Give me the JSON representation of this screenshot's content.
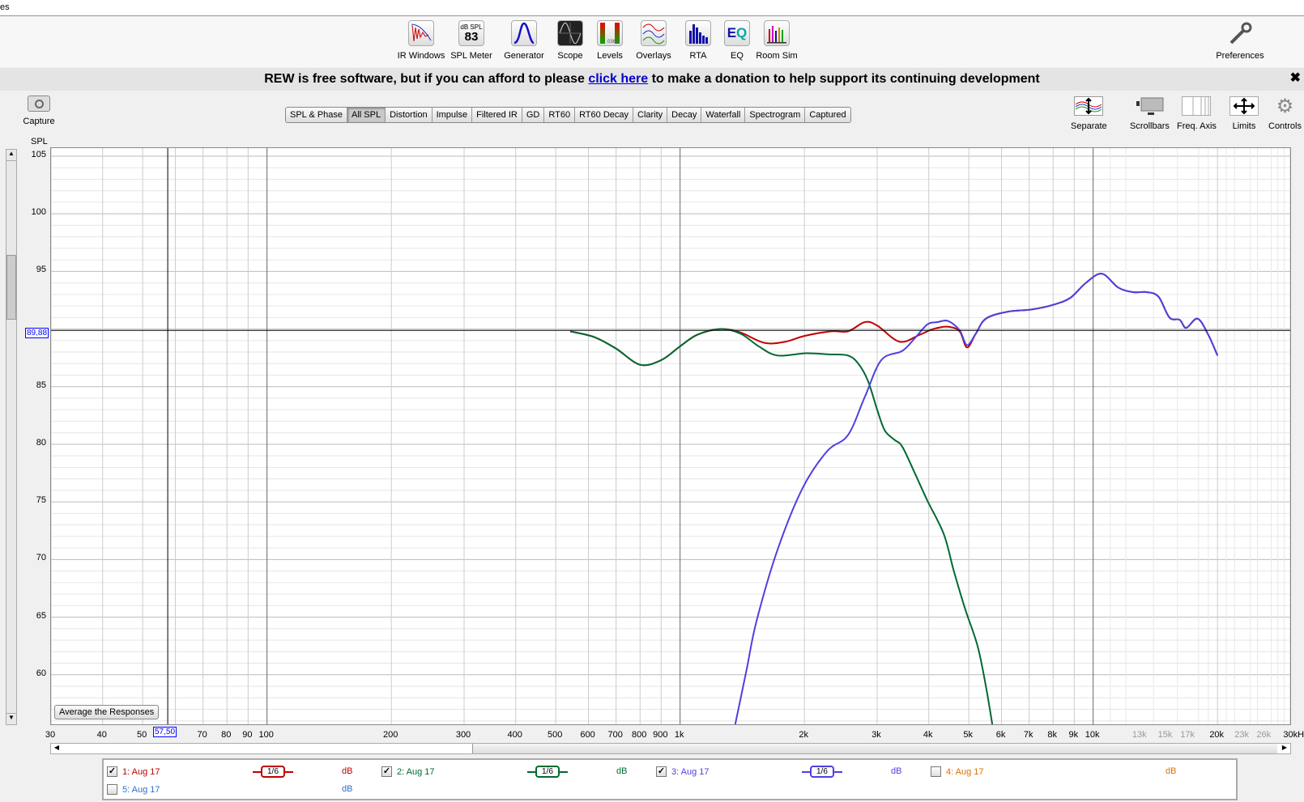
{
  "window": {
    "title_fragment": "es"
  },
  "toolbar": {
    "items": [
      {
        "label": "IR Windows",
        "icon": "ir-windows-icon"
      },
      {
        "label": "SPL Meter",
        "icon": "spl-meter-icon",
        "meter_unit": "dB SPL",
        "meter_value": "83"
      },
      {
        "label": "Generator",
        "icon": "generator-icon"
      },
      {
        "label": "Scope",
        "icon": "scope-icon"
      },
      {
        "label": "Levels",
        "icon": "levels-icon"
      },
      {
        "label": "Overlays",
        "icon": "overlays-icon"
      },
      {
        "label": "RTA",
        "icon": "rta-icon"
      },
      {
        "label": "EQ",
        "icon": "eq-icon"
      },
      {
        "label": "Room Sim",
        "icon": "room-sim-icon"
      }
    ],
    "preferences": "Preferences"
  },
  "banner": {
    "before": "REW is free software, but if you can afford to please ",
    "link": "click here",
    "after": " to make a donation to help support its continuing development",
    "close": "✖"
  },
  "capture": {
    "label": "Capture"
  },
  "tabs": [
    {
      "label": "SPL & Phase"
    },
    {
      "label": "All SPL",
      "active": true
    },
    {
      "label": "Distortion"
    },
    {
      "label": "Impulse"
    },
    {
      "label": "Filtered IR"
    },
    {
      "label": "GD"
    },
    {
      "label": "RT60"
    },
    {
      "label": "RT60 Decay"
    },
    {
      "label": "Clarity"
    },
    {
      "label": "Decay"
    },
    {
      "label": "Waterfall"
    },
    {
      "label": "Spectrogram"
    },
    {
      "label": "Captured"
    }
  ],
  "right_tools": [
    {
      "label": "Separate",
      "icon": "separate-icon"
    },
    {
      "label": "Scrollbars",
      "icon": "scrollbars-icon"
    },
    {
      "label": "Freq. Axis",
      "icon": "freq-axis-icon"
    },
    {
      "label": "Limits",
      "icon": "limits-icon"
    },
    {
      "label": "Controls",
      "icon": "gear-icon"
    }
  ],
  "average_button": "Average the Responses",
  "cursor": {
    "freq_label": "57,50",
    "spl_label": "89,88"
  },
  "legend": [
    {
      "label": "1: Aug 17",
      "checked": true,
      "smoothing": "1/6",
      "unit": "dB",
      "color": "#c00000"
    },
    {
      "label": "2: Aug 17",
      "checked": true,
      "smoothing": "1/6",
      "unit": "dB",
      "color": "#006a30"
    },
    {
      "label": "3: Aug 17",
      "checked": true,
      "smoothing": "1/6",
      "unit": "dB",
      "color": "#5040e0"
    },
    {
      "label": "4: Aug 17",
      "checked": false,
      "unit": "dB",
      "color": "#e07000"
    },
    {
      "label": "5: Aug 17",
      "checked": false,
      "unit": "dB",
      "color": "#2f6fd0"
    }
  ],
  "chart_data": {
    "type": "line",
    "ylabel": "SPL",
    "xscale": "log",
    "xlim": [
      30,
      30000
    ],
    "ylim": [
      55.7,
      105.7
    ],
    "yticks": [
      105,
      100,
      95,
      90,
      85,
      80,
      75,
      70,
      65,
      60
    ],
    "ytick_labels": [
      "105",
      "100",
      "95",
      "",
      "85",
      "80",
      "75",
      "70",
      "65",
      "60"
    ],
    "xticks": [
      {
        "f": 30,
        "label": "30"
      },
      {
        "f": 40,
        "label": "40"
      },
      {
        "f": 50,
        "label": "50"
      },
      {
        "f": 70,
        "label": "70"
      },
      {
        "f": 80,
        "label": "80"
      },
      {
        "f": 90,
        "label": "90"
      },
      {
        "f": 100,
        "label": "100"
      },
      {
        "f": 200,
        "label": "200"
      },
      {
        "f": 300,
        "label": "300"
      },
      {
        "f": 400,
        "label": "400"
      },
      {
        "f": 500,
        "label": "500"
      },
      {
        "f": 600,
        "label": "600"
      },
      {
        "f": 700,
        "label": "700"
      },
      {
        "f": 800,
        "label": "800"
      },
      {
        "f": 900,
        "label": "900"
      },
      {
        "f": 1000,
        "label": "1k"
      },
      {
        "f": 2000,
        "label": "2k"
      },
      {
        "f": 3000,
        "label": "3k"
      },
      {
        "f": 4000,
        "label": "4k"
      },
      {
        "f": 5000,
        "label": "5k"
      },
      {
        "f": 6000,
        "label": "6k"
      },
      {
        "f": 7000,
        "label": "7k"
      },
      {
        "f": 8000,
        "label": "8k"
      },
      {
        "f": 9000,
        "label": "9k"
      },
      {
        "f": 10000,
        "label": "10k"
      },
      {
        "f": 13000,
        "label": "13k",
        "dim": true
      },
      {
        "f": 15000,
        "label": "15k",
        "dim": true
      },
      {
        "f": 17000,
        "label": "17k",
        "dim": true
      },
      {
        "f": 20000,
        "label": "20k"
      },
      {
        "f": 23000,
        "label": "23k",
        "dim": true
      },
      {
        "f": 26000,
        "label": "26k",
        "dim": true
      },
      {
        "f": 30000,
        "label": "30kHz"
      }
    ],
    "cursor": {
      "x": 57.5,
      "y": 89.88
    },
    "grid": true,
    "series": [
      {
        "name": "1: Aug 17",
        "color": "#c00000",
        "x": [
          542,
          620,
          700,
          800,
          900,
          1000,
          1100,
          1250,
          1400,
          1600,
          1800,
          2000,
          2320,
          2550,
          2800,
          3000,
          3400,
          3800,
          4100,
          4450,
          4750,
          4950,
          5200,
          5500,
          6200,
          7100,
          8000,
          8800,
          9600,
          10500,
          11500,
          12500,
          13500,
          14400,
          15300,
          16200,
          16800,
          17900,
          19000,
          20000
        ],
        "y": [
          89.8,
          89.3,
          88.3,
          86.9,
          87.3,
          88.5,
          89.5,
          90.0,
          89.7,
          88.8,
          88.9,
          89.4,
          89.8,
          89.8,
          90.6,
          90.3,
          88.9,
          89.5,
          90.0,
          90.2,
          89.8,
          88.4,
          89.6,
          90.9,
          91.5,
          91.7,
          92.1,
          92.7,
          94.0,
          94.8,
          93.6,
          93.2,
          93.2,
          92.8,
          91.0,
          90.8,
          90.1,
          90.9,
          89.5,
          87.7
        ]
      },
      {
        "name": "2: Aug 17",
        "color": "#006a30",
        "x": [
          542,
          620,
          700,
          800,
          900,
          1000,
          1100,
          1250,
          1400,
          1550,
          1720,
          2020,
          2300,
          2550,
          2700,
          2850,
          3000,
          3130,
          3300,
          3450,
          3700,
          3970,
          4350,
          4600,
          4900,
          5250,
          5500,
          5700
        ],
        "y": [
          89.8,
          89.3,
          88.3,
          86.9,
          87.3,
          88.5,
          89.5,
          90.0,
          89.6,
          88.5,
          87.7,
          87.9,
          87.8,
          87.7,
          87.0,
          85.5,
          83.0,
          81.2,
          80.4,
          79.8,
          77.5,
          75.1,
          72.2,
          69.0,
          65.7,
          62.5,
          59.0,
          55.7
        ]
      },
      {
        "name": "3: Aug 17",
        "color": "#5040e0",
        "x": [
          1360,
          1450,
          1530,
          1720,
          1980,
          2270,
          2550,
          2800,
          3070,
          3450,
          3700,
          3970,
          4200,
          4450,
          4750,
          4950,
          5200,
          5500,
          6200,
          7100,
          8000,
          8800,
          9600,
          10500,
          11500,
          12500,
          13500,
          14400,
          15300,
          16200,
          16800,
          17900,
          19000,
          20000
        ],
        "y": [
          55.7,
          60.5,
          64.6,
          70.8,
          76.2,
          79.4,
          80.8,
          84.1,
          87.3,
          88.1,
          89.2,
          90.4,
          90.6,
          90.7,
          89.9,
          88.6,
          89.6,
          90.9,
          91.5,
          91.7,
          92.1,
          92.7,
          94.0,
          94.8,
          93.6,
          93.2,
          93.2,
          92.8,
          91.0,
          90.8,
          90.1,
          90.9,
          89.5,
          87.7
        ]
      }
    ]
  }
}
